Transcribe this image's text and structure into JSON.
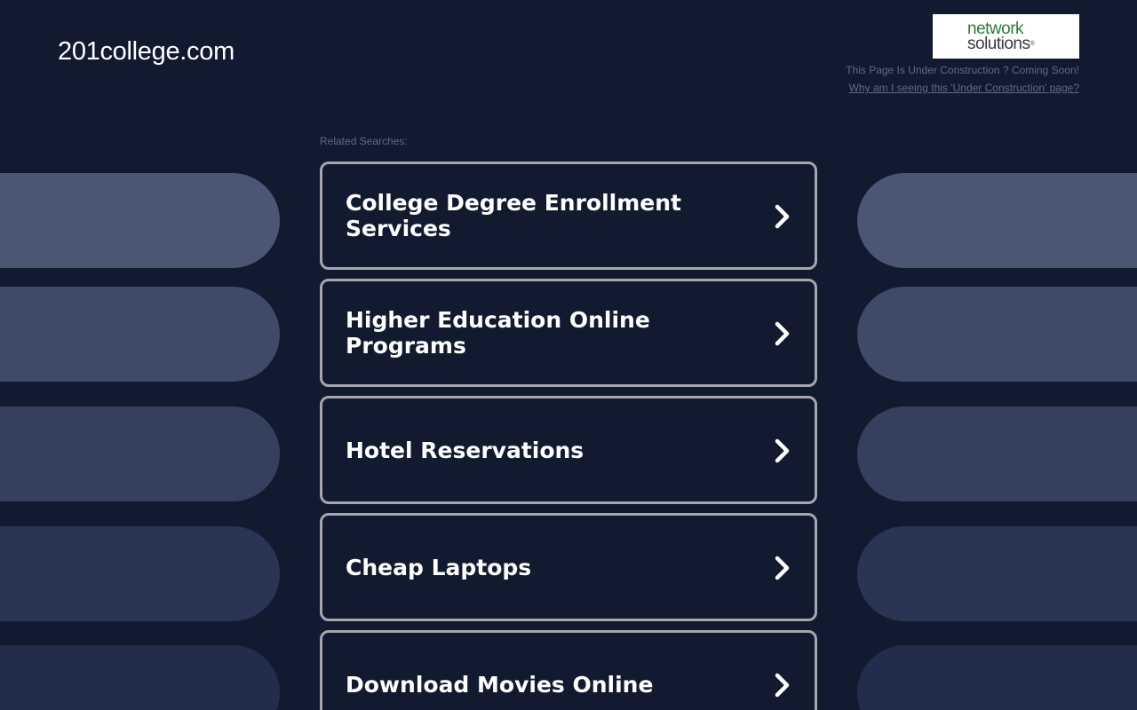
{
  "header": {
    "site_title": "201college.com",
    "logo": {
      "line1": "network",
      "line2": "solutions",
      "reg_mark": "®"
    },
    "construction_text": "This Page Is Under Construction ? Coming Soon!",
    "why_link": "Why am I seeing this 'Under Construction' page?"
  },
  "related": {
    "label": "Related Searches:",
    "items": [
      {
        "label": "College Degree Enrollment Services"
      },
      {
        "label": "Higher Education Online Programs"
      },
      {
        "label": "Hotel Reservations"
      },
      {
        "label": "Cheap Laptops"
      },
      {
        "label": "Download Movies Online"
      }
    ]
  },
  "colors": {
    "background": "#121a30",
    "card_border": "#a5a7ac",
    "muted_text": "#5f6b85",
    "logo_green": "#2d7a3a"
  },
  "icons": {
    "result_arrow": "chevron-right-icon"
  }
}
